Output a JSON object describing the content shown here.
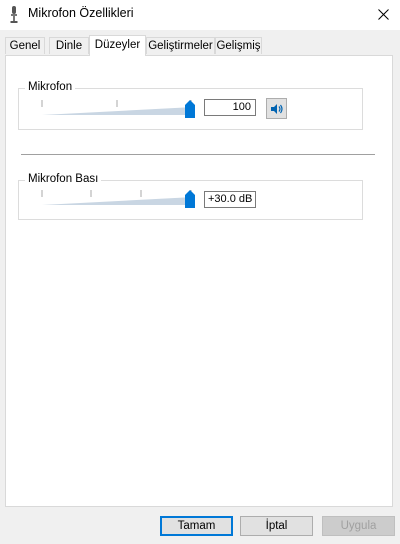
{
  "window": {
    "title": "Mikrofon Özellikleri"
  },
  "tabs": [
    {
      "label": "Genel",
      "active": false
    },
    {
      "label": "Dinle",
      "active": false
    },
    {
      "label": "Düzeyler",
      "active": true
    },
    {
      "label": "Geliştirmeler",
      "active": false
    },
    {
      "label": "Gelişmiş",
      "active": false
    }
  ],
  "levels": {
    "microphone": {
      "label": "Mikrofon",
      "value": "100",
      "level_percent": 100
    },
    "boost": {
      "label": "Mikrofon Bası",
      "value": "+30.0 dB",
      "level_percent": 100
    }
  },
  "buttons": {
    "ok": "Tamam",
    "cancel": "İptal",
    "apply": "Uygula"
  },
  "colors": {
    "accent": "#0078d7",
    "slider_track": "#c9d6e3"
  }
}
